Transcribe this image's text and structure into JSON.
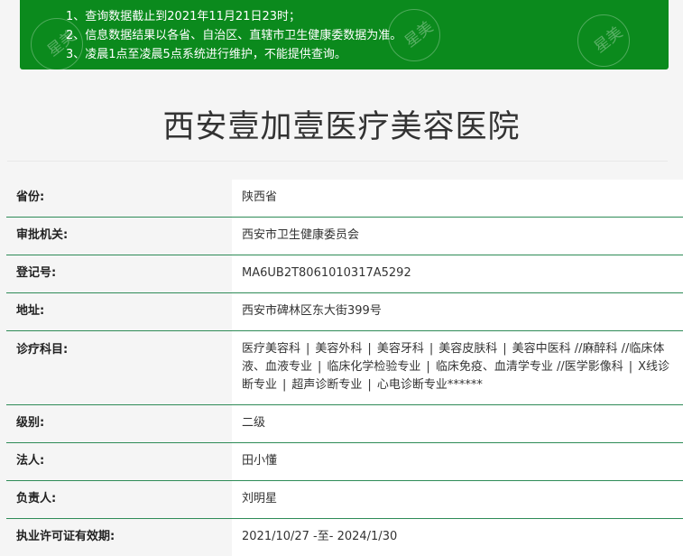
{
  "notice": {
    "items": [
      "1、查询数据截止到2021年11月21日23时；",
      "2、信息数据结果以各省、自治区、直辖市卫生健康委数据为准。",
      "3、凌晨1点至凌晨5点系统进行维护，不能提供查询。"
    ],
    "watermark_text": "星美"
  },
  "hospital": {
    "name": "西安壹加壹医疗美容医院"
  },
  "fields": {
    "province": {
      "label": "省份:",
      "value": "陕西省"
    },
    "authority": {
      "label": "审批机关:",
      "value": "西安市卫生健康委员会"
    },
    "reg_no": {
      "label": "登记号:",
      "value": "MA6UB2T8061010317A5292"
    },
    "address": {
      "label": "地址:",
      "value": "西安市碑林区东大街399号"
    },
    "departments": {
      "label": "诊疗科目:",
      "items": [
        "医疗美容科",
        "美容外科",
        "美容牙科",
        "美容皮肤科",
        "美容中医科 //麻醉科 //临床体液、血液专业",
        "临床化学检验专业",
        "临床免疫、血清学专业 //医学影像科",
        "X线诊断专业",
        "超声诊断专业",
        "心电诊断专业******"
      ]
    },
    "level": {
      "label": "级别:",
      "value": "二级"
    },
    "legal_person": {
      "label": "法人:",
      "value": "田小懂"
    },
    "person_in_charge": {
      "label": "负责人:",
      "value": "刘明星"
    },
    "license_validity": {
      "label": "执业许可证有效期:",
      "value": "2021/10/27 -至- 2024/1/30"
    }
  },
  "colors": {
    "notice_bg": "#0b8a1d",
    "row_border": "#2e8b57",
    "label_bg": "#f5f5f5"
  }
}
